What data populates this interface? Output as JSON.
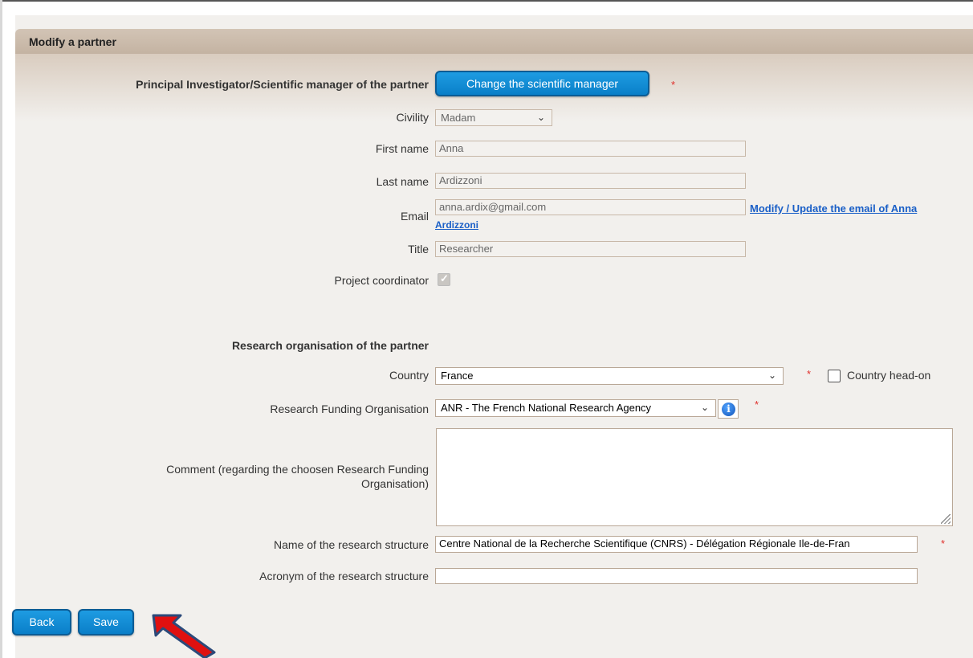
{
  "panel": {
    "title": "Modify a partner"
  },
  "scientific_manager": {
    "section_label": "Principal Investigator/Scientific manager of the partner",
    "change_button": "Change the scientific manager",
    "required": "*"
  },
  "person": {
    "civility_label": "Civility",
    "civility_value": "Madam",
    "first_name_label": "First name",
    "first_name_value": "Anna",
    "last_name_label": "Last name",
    "last_name_value": "Ardizzoni",
    "email_label": "Email",
    "email_value": "anna.ardix@gmail.com",
    "email_link_line1": "Modify / Update the email of Anna",
    "email_link_line2": "Ardizzoni",
    "title_label": "Title",
    "title_value": "Researcher",
    "coordinator_label": "Project coordinator",
    "coordinator_checked": true
  },
  "organisation": {
    "section_label": "Research organisation of the partner",
    "country_label": "Country",
    "country_value": "France",
    "country_required": "*",
    "country_head_label": "Country head-on",
    "funding_label": "Research Funding Organisation",
    "funding_value": "ANR - The French National Research Agency",
    "funding_required": "*",
    "info_icon": "info-icon",
    "comment_label_line1": "Comment (regarding the choosen Research Funding",
    "comment_label_line2": "Organisation)",
    "comment_value": "",
    "structure_label": "Name of the research structure",
    "structure_value": "Centre National de la Recherche Scientifique (CNRS) - Délégation Régionale Ile-de-Fran",
    "structure_required": "*",
    "acronym_label": "Acronym of the research structure",
    "acronym_value": ""
  },
  "actions": {
    "back": "Back",
    "save": "Save"
  },
  "colors": {
    "button": "#1e9ce2",
    "required": "#e0302c",
    "annotation_arrow": "#e01010"
  }
}
